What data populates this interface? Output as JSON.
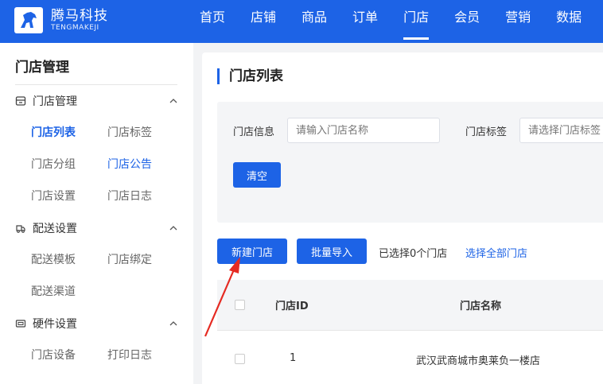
{
  "brand": {
    "name_cn": "腾马科技",
    "name_en": "TENGMAKEJI",
    "color": "#1d63e6"
  },
  "nav": {
    "items": [
      {
        "label": "首页"
      },
      {
        "label": "店铺"
      },
      {
        "label": "商品"
      },
      {
        "label": "订单"
      },
      {
        "label": "门店",
        "active": true
      },
      {
        "label": "会员"
      },
      {
        "label": "营销"
      },
      {
        "label": "数据"
      }
    ]
  },
  "sidebar": {
    "title": "门店管理",
    "groups": [
      {
        "label": "门店管理",
        "icon": "store-icon",
        "items": [
          "门店列表",
          "门店标签",
          "门店分组",
          "门店公告",
          "门店设置",
          "门店日志"
        ]
      },
      {
        "label": "配送设置",
        "icon": "delivery-icon",
        "items": [
          "配送模板",
          "门店绑定",
          "配送渠道"
        ]
      },
      {
        "label": "硬件设置",
        "icon": "hardware-icon",
        "items": [
          "门店设备",
          "打印日志"
        ]
      }
    ],
    "active_item": "门店列表",
    "highlighted_item": "门店公告"
  },
  "main": {
    "title": "门店列表",
    "filter": {
      "store_info_label": "门店信息",
      "store_info_placeholder": "请输入门店名称",
      "store_tag_label": "门店标签",
      "store_tag_placeholder": "请选择门店标签",
      "clear_label": "清空"
    },
    "actions": {
      "new_store_label": "新建门店",
      "batch_import_label": "批量导入",
      "selected_info": "已选择0个门店",
      "select_all_label": "选择全部门店"
    },
    "table": {
      "columns": [
        "门店ID",
        "门店名称"
      ],
      "rows": [
        {
          "id": "1",
          "name": "武汉武商城市奥莱负一楼店"
        }
      ]
    }
  },
  "annotation": {
    "arrow_color": "#e52a22"
  }
}
